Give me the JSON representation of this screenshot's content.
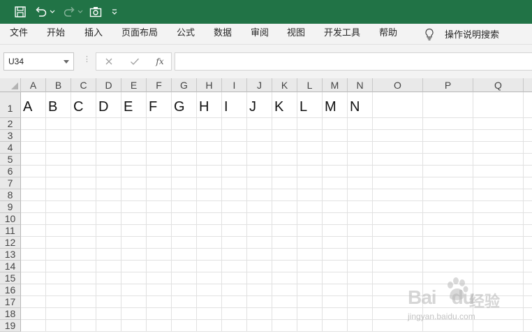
{
  "quick_access": {
    "buttons": [
      "save-icon",
      "undo-icon",
      "redo-icon",
      "camera-icon",
      "customize-qat-icon"
    ]
  },
  "ribbon": {
    "tabs": [
      "文件",
      "开始",
      "插入",
      "页面布局",
      "公式",
      "数据",
      "审阅",
      "视图",
      "开发工具",
      "帮助"
    ],
    "tell_me": "操作说明搜索"
  },
  "formula_bar": {
    "name_box": "U34",
    "fx_label": "fx",
    "formula": ""
  },
  "sheet": {
    "columns": [
      "A",
      "B",
      "C",
      "D",
      "E",
      "F",
      "G",
      "H",
      "I",
      "J",
      "K",
      "L",
      "M",
      "N",
      "O",
      "P",
      "Q"
    ],
    "rows": [
      "1",
      "2",
      "3",
      "4",
      "5",
      "6",
      "7",
      "8",
      "9",
      "10",
      "11",
      "12",
      "13",
      "14",
      "15",
      "16",
      "17",
      "18",
      "19"
    ],
    "row1_values": [
      "A",
      "B",
      "C",
      "D",
      "E",
      "F",
      "G",
      "H",
      "I",
      "J",
      "K",
      "L",
      "M",
      "N"
    ]
  },
  "watermark": {
    "logo_text": "Bai",
    "logo_text2": "du",
    "cn_text": "经验",
    "url": "jingyan.baidu.com"
  },
  "colors": {
    "title_bar": "#217346",
    "ribbon_bg": "#f3f3f3",
    "header_bg": "#e9e9e9",
    "gridline": "#e1e1e1"
  }
}
